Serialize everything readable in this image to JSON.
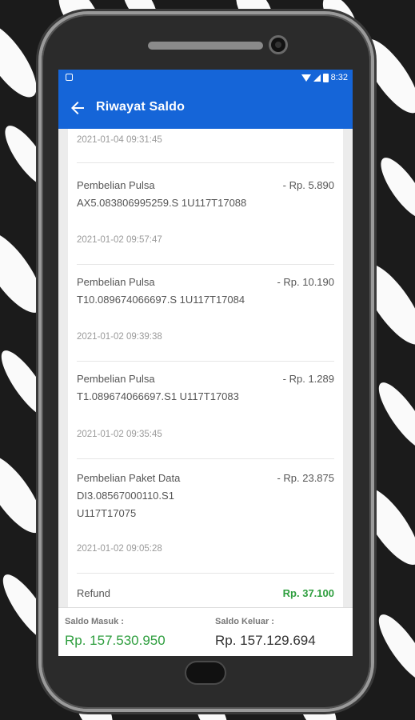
{
  "status_bar": {
    "time": "8:32"
  },
  "app_bar": {
    "title": "Riwayat Saldo"
  },
  "transactions": [
    {
      "title": "",
      "amount": "",
      "date": "2021-01-04 09:31:45"
    },
    {
      "title": "Pembelian Pulsa AX5.083806995259.S 1U117T17088",
      "amount": "- Rp. 5.890",
      "date": "2021-01-02 09:57:47"
    },
    {
      "title": "Pembelian Pulsa T10.089674066697.S 1U117T17084",
      "amount": "- Rp. 10.190",
      "date": "2021-01-02 09:39:38"
    },
    {
      "title": "Pembelian Pulsa T1.089674066697.S1 U117T17083",
      "amount": "- Rp. 1.289",
      "date": "2021-01-02 09:35:45"
    },
    {
      "title": "Pembelian Paket Data DI3.08567000110.S1 U117T17075",
      "amount": "- Rp. 23.875",
      "date": "2021-01-02 09:05:28"
    },
    {
      "title": "Refund",
      "amount": "Rp. 37.100",
      "date": ""
    }
  ],
  "footer": {
    "in_label": "Saldo Masuk :",
    "in_value": "Rp. 157.530.950",
    "out_label": "Saldo Keluar :",
    "out_value": "Rp. 157.129.694"
  },
  "colors": {
    "primary": "#1565d8",
    "positive": "#2e9e3e"
  }
}
